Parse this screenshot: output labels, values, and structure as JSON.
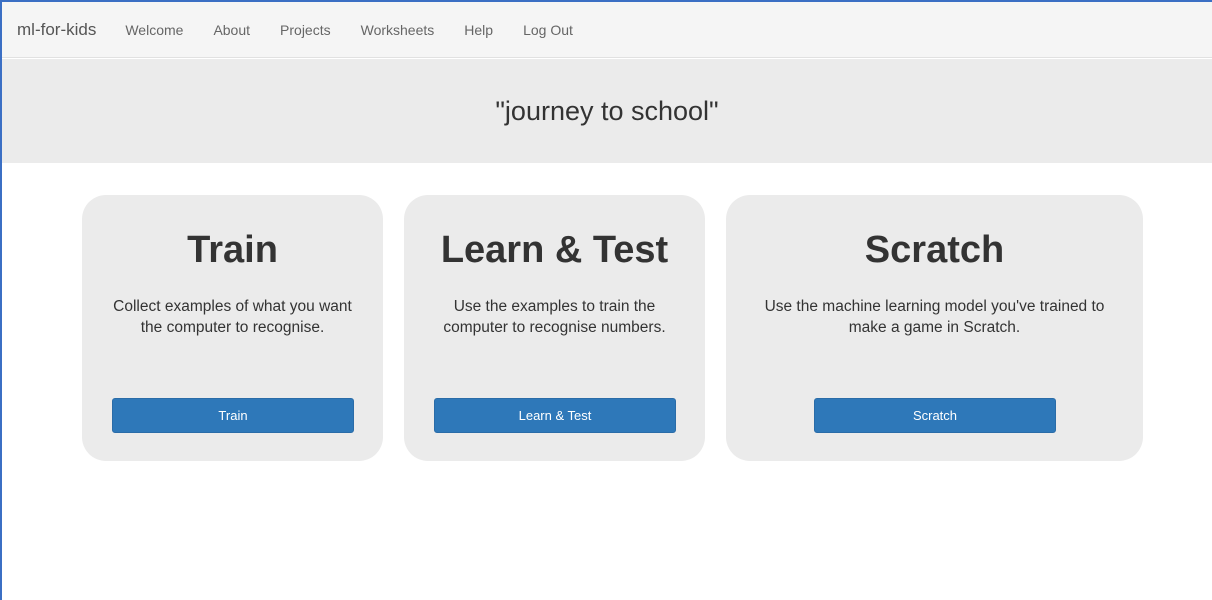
{
  "navbar": {
    "brand": "ml-for-kids",
    "links": [
      "Welcome",
      "About",
      "Projects",
      "Worksheets",
      "Help",
      "Log Out"
    ]
  },
  "project": {
    "title": "\"journey to school\""
  },
  "cards": [
    {
      "title": "Train",
      "description": "Collect examples of what you want the computer to recognise.",
      "button_label": "Train"
    },
    {
      "title": "Learn & Test",
      "description": "Use the examples to train the computer to recognise numbers.",
      "button_label": "Learn & Test"
    },
    {
      "title": "Scratch",
      "description": "Use the machine learning model you've trained to make a game in Scratch.",
      "button_label": "Scratch"
    }
  ],
  "colors": {
    "button": "#2e78b9",
    "card_background": "#ebebeb",
    "navbar_background": "#f5f5f5",
    "window_border": "#3b6fc4"
  }
}
